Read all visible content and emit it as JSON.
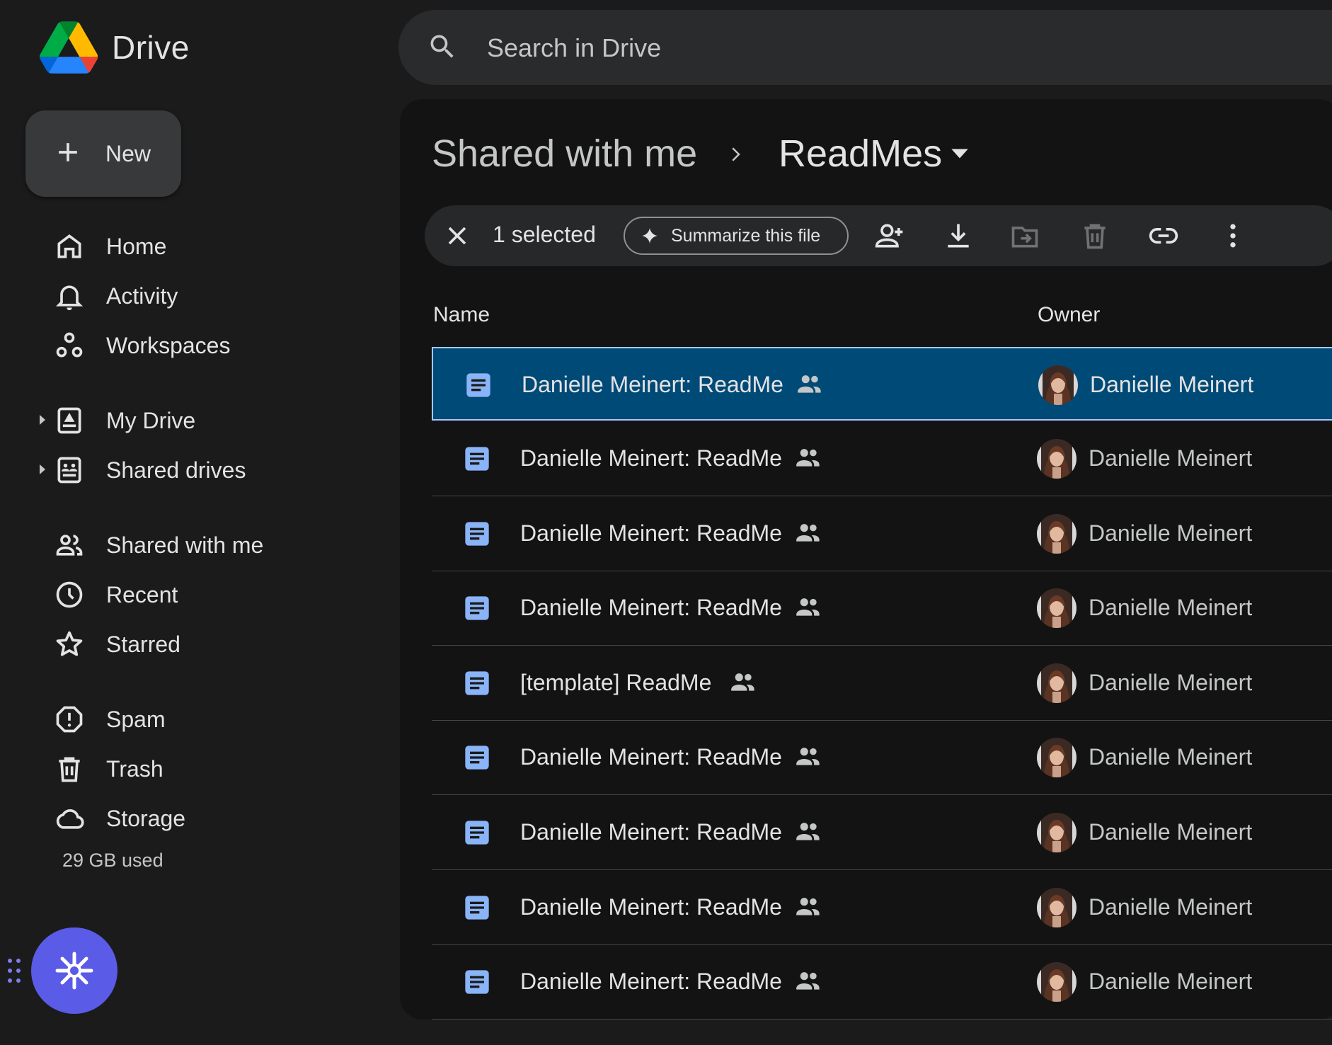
{
  "app": {
    "title": "Drive"
  },
  "search": {
    "placeholder": "Search in Drive"
  },
  "new_button": {
    "label": "New"
  },
  "nav": [
    {
      "label": "Home",
      "icon": "home-icon"
    },
    {
      "label": "Activity",
      "icon": "bell-icon"
    },
    {
      "label": "Workspaces",
      "icon": "workspaces-icon"
    },
    {
      "label": "My Drive",
      "icon": "my-drive-icon"
    },
    {
      "label": "Shared drives",
      "icon": "shared-drives-icon"
    },
    {
      "label": "Shared with me",
      "icon": "people-icon"
    },
    {
      "label": "Recent",
      "icon": "clock-icon"
    },
    {
      "label": "Starred",
      "icon": "star-icon"
    },
    {
      "label": "Spam",
      "icon": "spam-icon"
    },
    {
      "label": "Trash",
      "icon": "trash-icon"
    },
    {
      "label": "Storage",
      "icon": "cloud-icon"
    }
  ],
  "storage": {
    "used": "29 GB used"
  },
  "breadcrumb": {
    "parent": "Shared with me",
    "current": "ReadMes"
  },
  "toolbar": {
    "selected": "1 selected",
    "summarize": "Summarize this file"
  },
  "columns": {
    "name": "Name",
    "owner": "Owner"
  },
  "files": [
    {
      "name": "Danielle Meinert: ReadMe",
      "owner": "Danielle Meinert",
      "selected": true
    },
    {
      "name": "Danielle Meinert: ReadMe",
      "owner": "Danielle Meinert"
    },
    {
      "name": "Danielle Meinert: ReadMe",
      "owner": "Danielle Meinert"
    },
    {
      "name": "Danielle Meinert: ReadMe",
      "owner": "Danielle Meinert"
    },
    {
      "name": "[template] ReadMe",
      "owner": "Danielle Meinert"
    },
    {
      "name": "Danielle Meinert: ReadMe",
      "owner": "Danielle Meinert"
    },
    {
      "name": "Danielle Meinert: ReadMe",
      "owner": "Danielle Meinert"
    },
    {
      "name": "Danielle Meinert: ReadMe",
      "owner": "Danielle Meinert"
    },
    {
      "name": "Danielle Meinert: ReadMe",
      "owner": "Danielle Meinert"
    }
  ],
  "colors": {
    "background": "#1b1b1b",
    "main": "#131314",
    "selected_row": "#004a77",
    "doc_icon": "#8ab4f8",
    "fab": "#5a5be6"
  }
}
